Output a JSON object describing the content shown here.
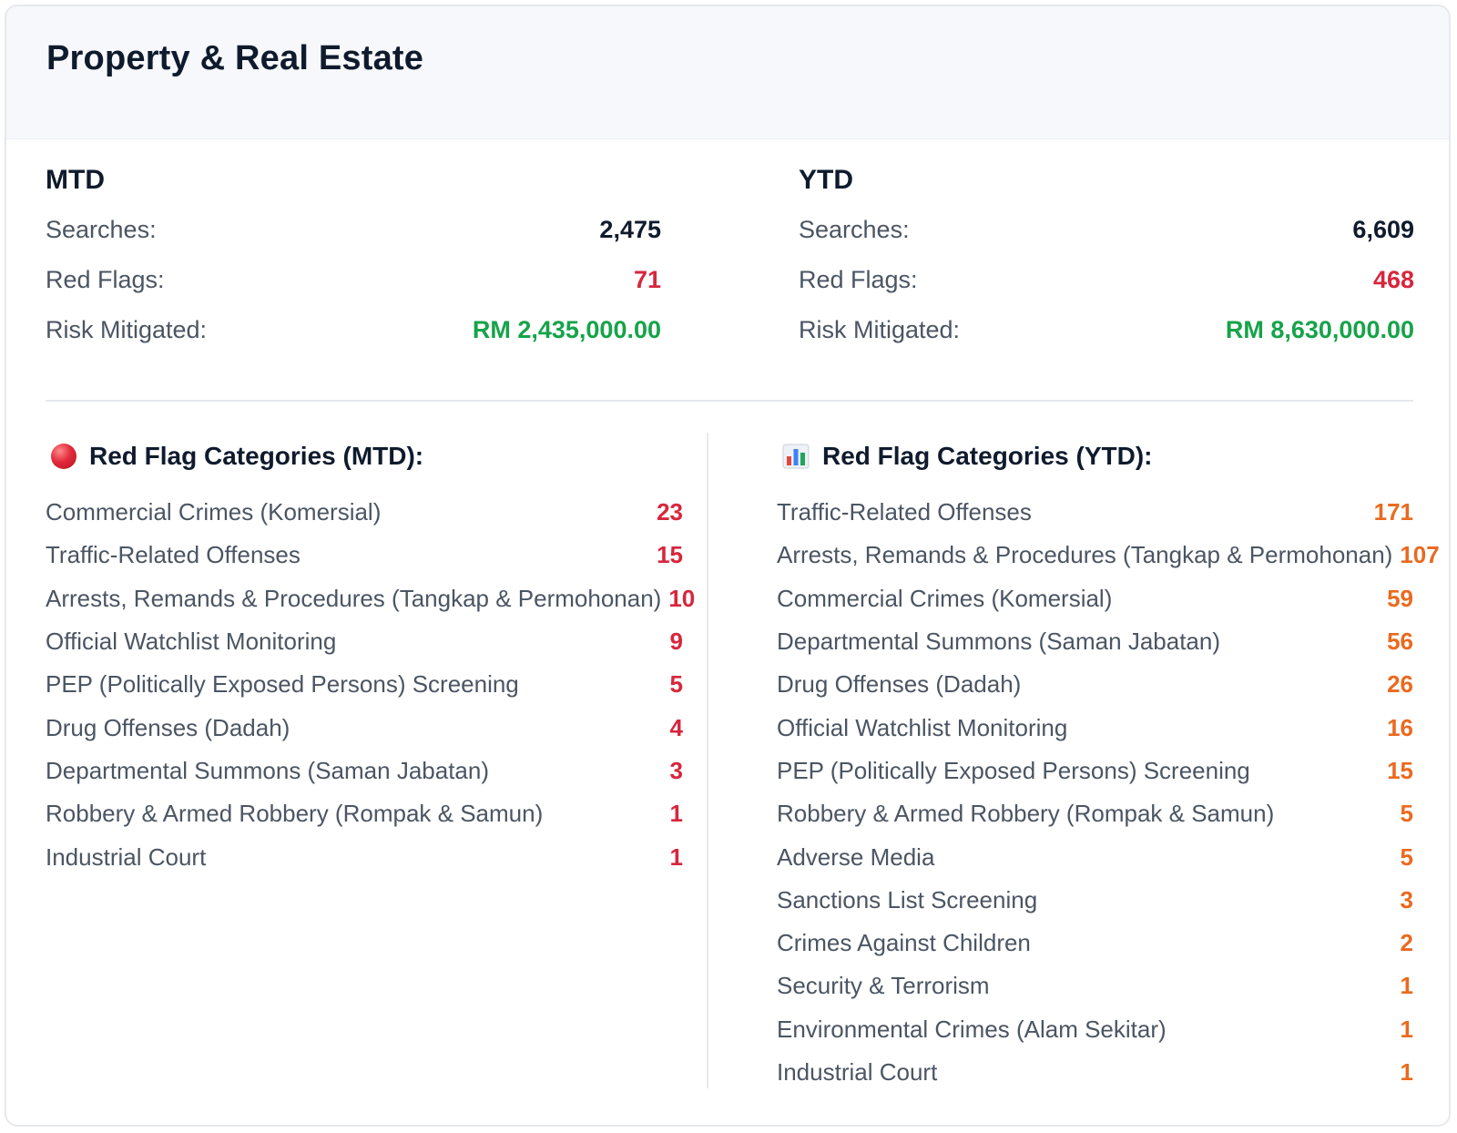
{
  "header": {
    "title": "Property & Real Estate"
  },
  "mtd": {
    "title": "MTD",
    "stats": [
      {
        "label": "Searches:",
        "value": "2,475"
      },
      {
        "label": "Red Flags:",
        "value": "71"
      },
      {
        "label": "Risk Mitigated:",
        "value": "RM 2,435,000.00"
      }
    ],
    "categories_title": "Red Flag Categories (MTD):",
    "categories_icon": "red-circle-icon",
    "categories": [
      {
        "name": "Commercial Crimes (Komersial)",
        "count": "23"
      },
      {
        "name": "Traffic-Related Offenses",
        "count": "15"
      },
      {
        "name": "Arrests, Remands & Procedures (Tangkap & Permohonan)",
        "count": "10"
      },
      {
        "name": "Official Watchlist Monitoring",
        "count": "9"
      },
      {
        "name": "PEP (Politically Exposed Persons) Screening",
        "count": "5"
      },
      {
        "name": "Drug Offenses (Dadah)",
        "count": "4"
      },
      {
        "name": "Departmental Summons (Saman Jabatan)",
        "count": "3"
      },
      {
        "name": "Robbery & Armed Robbery (Rompak & Samun)",
        "count": "1"
      },
      {
        "name": "Industrial Court",
        "count": "1"
      }
    ]
  },
  "ytd": {
    "title": "YTD",
    "stats": [
      {
        "label": "Searches:",
        "value": "6,609"
      },
      {
        "label": "Red Flags:",
        "value": "468"
      },
      {
        "label": "Risk Mitigated:",
        "value": "RM 8,630,000.00"
      }
    ],
    "categories_title": "Red Flag Categories (YTD):",
    "categories_icon": "bar-chart-icon",
    "categories": [
      {
        "name": "Traffic-Related Offenses",
        "count": "171"
      },
      {
        "name": "Arrests, Remands & Procedures (Tangkap & Permohonan)",
        "count": "107"
      },
      {
        "name": "Commercial Crimes (Komersial)",
        "count": "59"
      },
      {
        "name": "Departmental Summons (Saman Jabatan)",
        "count": "56"
      },
      {
        "name": "Drug Offenses (Dadah)",
        "count": "26"
      },
      {
        "name": "Official Watchlist Monitoring",
        "count": "16"
      },
      {
        "name": "PEP (Politically Exposed Persons) Screening",
        "count": "15"
      },
      {
        "name": "Robbery & Armed Robbery (Rompak & Samun)",
        "count": "5"
      },
      {
        "name": "Adverse Media",
        "count": "5"
      },
      {
        "name": "Sanctions List Screening",
        "count": "3"
      },
      {
        "name": "Crimes Against Children",
        "count": "2"
      },
      {
        "name": "Security & Terrorism",
        "count": "1"
      },
      {
        "name": "Environmental Crimes (Alam Sekitar)",
        "count": "1"
      },
      {
        "name": "Industrial Court",
        "count": "1"
      }
    ]
  },
  "colors": {
    "title": "#0f1b2d",
    "label": "#4b5563",
    "red_flag": "#d7263d",
    "risk_green": "#16a34a",
    "ytd_count_orange": "#ea6a1f",
    "header_bg": "#f6f8fb",
    "divider": "#e6e9ee"
  }
}
